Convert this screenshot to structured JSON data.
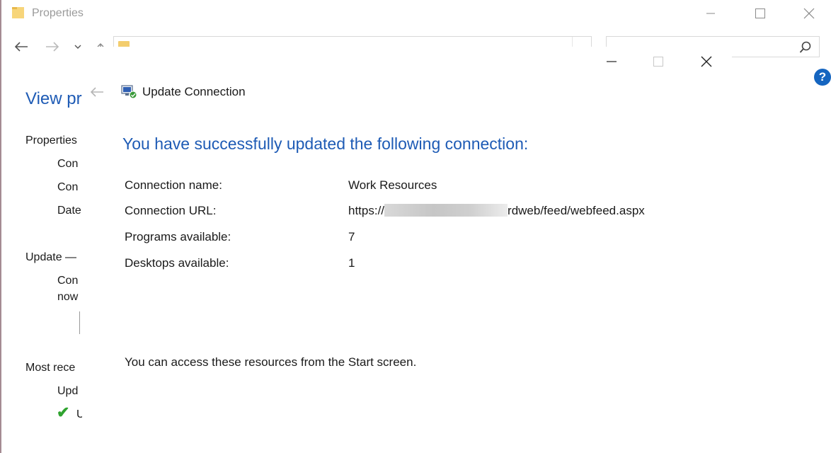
{
  "background_window": {
    "title": "Properties",
    "heading": "View pr",
    "left_texts": {
      "properties": "Properties",
      "con1": "Con",
      "con2": "Con",
      "date": "Date",
      "update": "Update —",
      "con3": "Con",
      "now": "now",
      "most_recent": "Most rece",
      "upd": "Upd",
      "u": "U"
    },
    "help_label": "?"
  },
  "dialog": {
    "title": "Update Connection",
    "headline": "You have successfully updated the following connection:",
    "rows": [
      {
        "label": "Connection name:",
        "value": "Work Resources"
      },
      {
        "label": "Connection URL:",
        "value_prefix": "https://",
        "value_suffix": "rdweb/feed/webfeed.aspx"
      },
      {
        "label": "Programs available:",
        "value": "7"
      },
      {
        "label": "Desktops available:",
        "value": "1"
      }
    ],
    "footer": "You can access these resources from the Start screen."
  },
  "icons": {
    "folder": "folder-icon",
    "back": "back-arrow-icon",
    "forward": "forward-arrow-icon",
    "search": "search-icon",
    "help": "help-icon",
    "success": "checkmark-icon",
    "connection": "remote-connection-icon"
  },
  "colors": {
    "heading_blue": "#1e5bb5",
    "help_blue": "#1565c0",
    "check_green": "#2fa32f"
  }
}
